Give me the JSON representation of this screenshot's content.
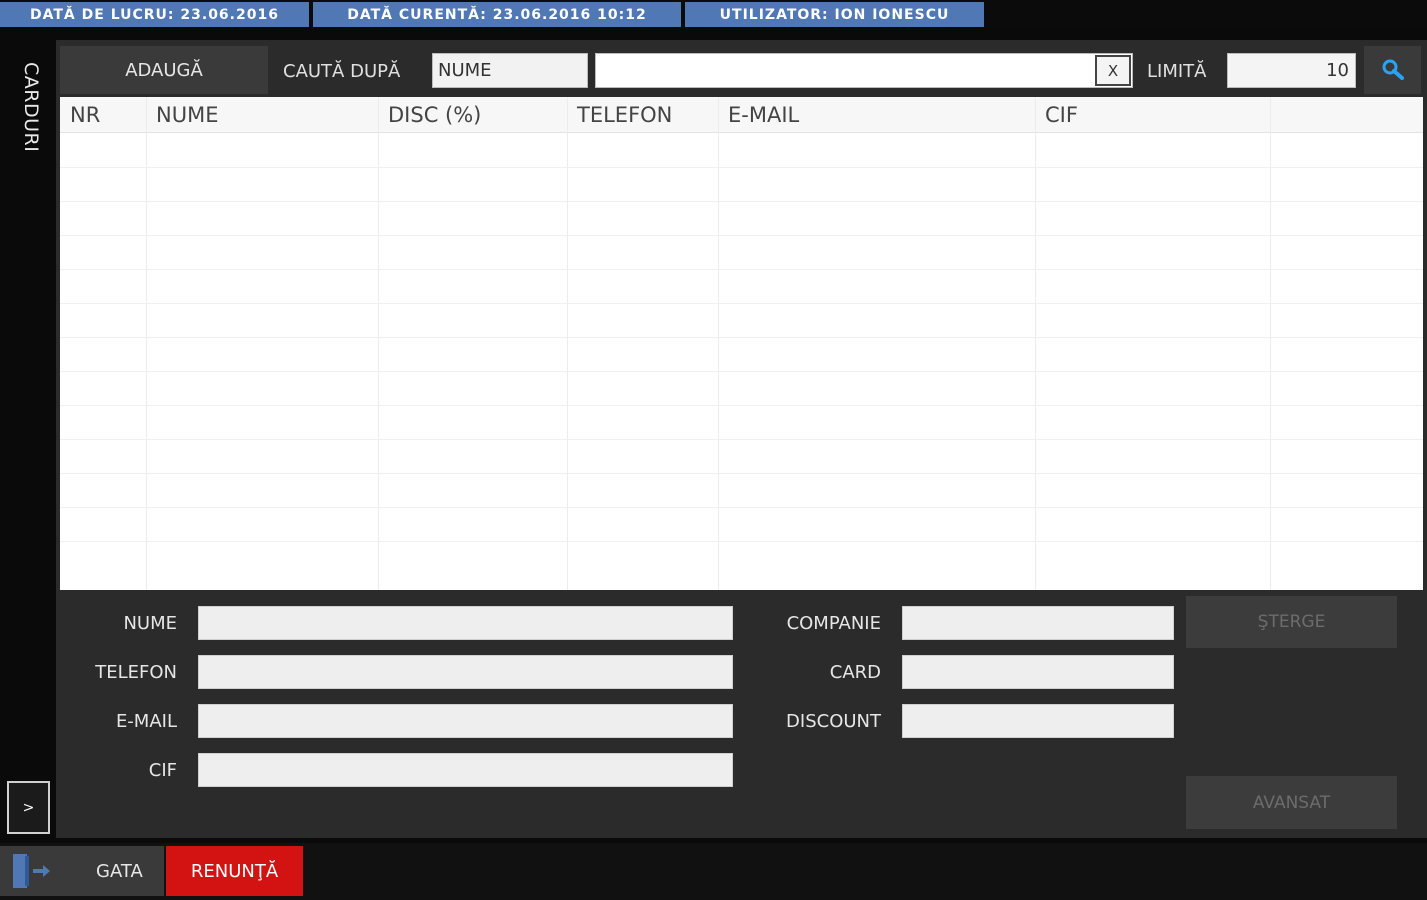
{
  "topbar": {
    "work_date": "DATĂ DE LUCRU: 23.06.2016",
    "current_date": "DATĂ CURENTĂ: 23.06.2016 10:12",
    "user": "UTILIZATOR: ION IONESCU"
  },
  "sidebar": {
    "title": "CARDURI",
    "expand_label": ">"
  },
  "toolbar": {
    "add_label": "ADAUGĂ",
    "search_by_label": "CAUTĂ DUPĂ",
    "search_field_value": "NUME",
    "search_text": "",
    "clear_label": "X",
    "limit_label": "LIMITĂ",
    "limit_value": "10"
  },
  "table": {
    "columns": [
      "NR",
      "NUME",
      "DISC (%)",
      "TELEFON",
      "E-MAIL",
      "CIF",
      ""
    ],
    "rows": []
  },
  "form": {
    "left_fields": [
      {
        "label": "NUME",
        "value": ""
      },
      {
        "label": "TELEFON",
        "value": ""
      },
      {
        "label": "E-MAIL",
        "value": ""
      },
      {
        "label": "CIF",
        "value": ""
      }
    ],
    "right_fields": [
      {
        "label": "COMPANIE",
        "value": ""
      },
      {
        "label": "CARD",
        "value": ""
      },
      {
        "label": "DISCOUNT",
        "value": ""
      }
    ],
    "delete_label": "ŞTERGE",
    "advanced_label": "AVANSAT"
  },
  "footer": {
    "done_label": "GATA",
    "cancel_label": "RENUNŢĂ"
  },
  "colors": {
    "accent_blue": "#4f78b5",
    "search_icon": "#2aa3f2",
    "cancel_red": "#d31212"
  }
}
